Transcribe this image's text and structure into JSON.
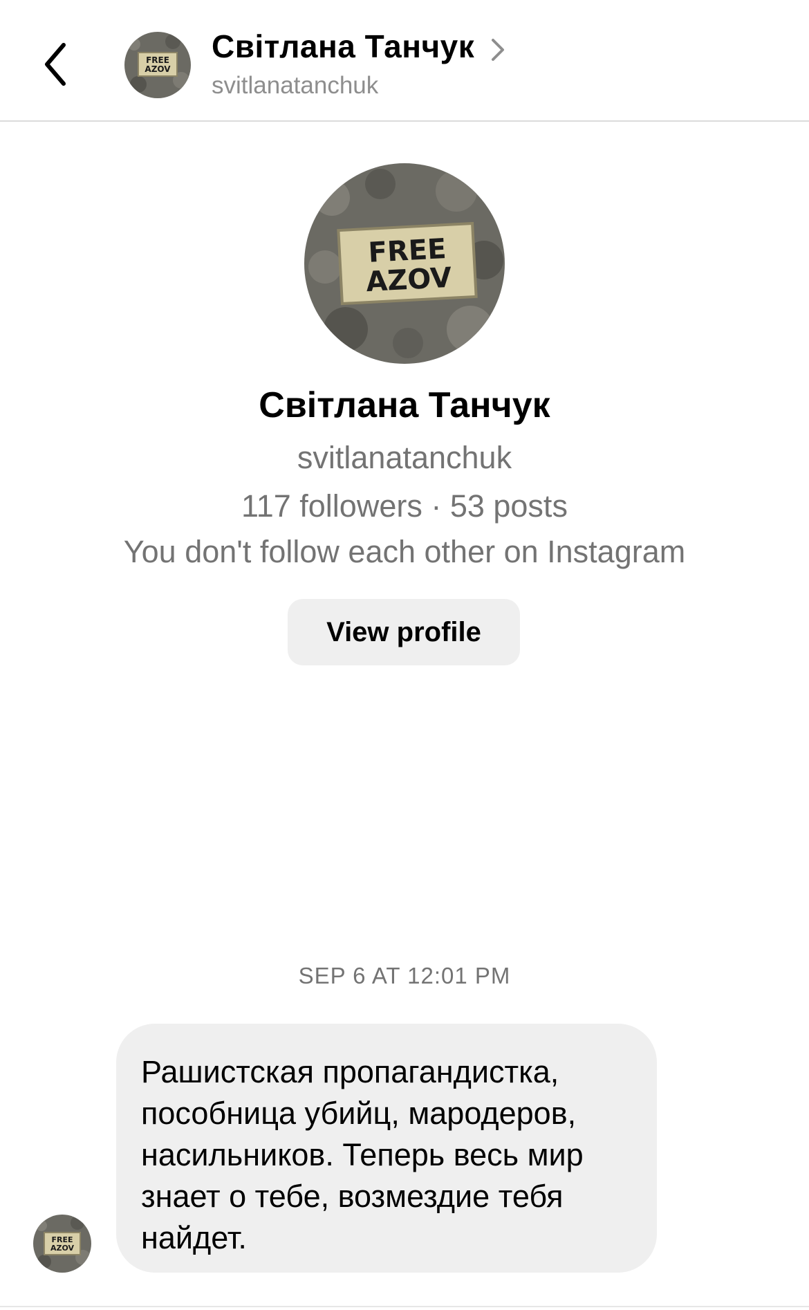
{
  "header": {
    "back_icon": "chevron-left-icon",
    "name": "Світлана Танчук",
    "username": "svitlanatanchuk",
    "chevron_icon": "chevron-right-icon"
  },
  "avatar": {
    "line1": "FREE",
    "line2": "AZOV",
    "background_color": "#6b6a63",
    "badge_color": "#d8cfa8"
  },
  "profile": {
    "name": "Світлана Танчук",
    "username": "svitlanatanchuk",
    "stats": "117 followers · 53 posts",
    "follow_note": "You don't follow each other on Instagram",
    "view_profile_label": "View profile"
  },
  "conversation": {
    "timestamp": "SEP 6 AT 12:01 PM",
    "messages": [
      {
        "text": "Рашистская пропагандистка,\nпособница убийц, мародеров,\nнасильников. Теперь весь мир\nзнает о тебе, возмездие тебя\nнайдет."
      }
    ]
  }
}
